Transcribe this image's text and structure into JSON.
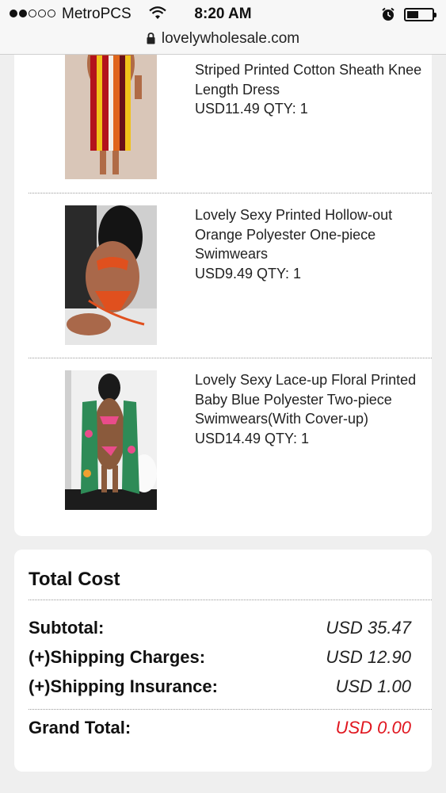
{
  "status_bar": {
    "carrier": "MetroPCS",
    "time": "8:20 AM",
    "url": "lovelywholesale.com"
  },
  "items": [
    {
      "title_partial": "Striped Printed Cotton Sheath Knee Length Dress",
      "price_qty": "USD11.49 QTY: 1",
      "image": "striped-dress-photo"
    },
    {
      "title": "Lovely Sexy Printed Hollow-out Orange Polyester One-piece Swimwears",
      "price_qty": "USD9.49 QTY: 1",
      "image": "orange-swimwear-photo"
    },
    {
      "title": "Lovely Sexy Lace-up Floral Printed Baby Blue Polyester Two-piece Swimwears(With Cover-up)",
      "price_qty": "USD14.49 QTY: 1",
      "image": "floral-swimwear-photo"
    }
  ],
  "totals": {
    "heading": "Total Cost",
    "subtotal_label": "Subtotal:",
    "subtotal_value": "USD 35.47",
    "shipping_label": "(+)Shipping Charges:",
    "shipping_value": "USD 12.90",
    "insurance_label": "(+)Shipping Insurance:",
    "insurance_value": "USD 1.00",
    "grand_label": "Grand Total:",
    "grand_value": "USD 0.00"
  },
  "colors": {
    "grand_total": "#e0161f",
    "card_bg": "#ffffff",
    "page_bg": "#efefef"
  }
}
